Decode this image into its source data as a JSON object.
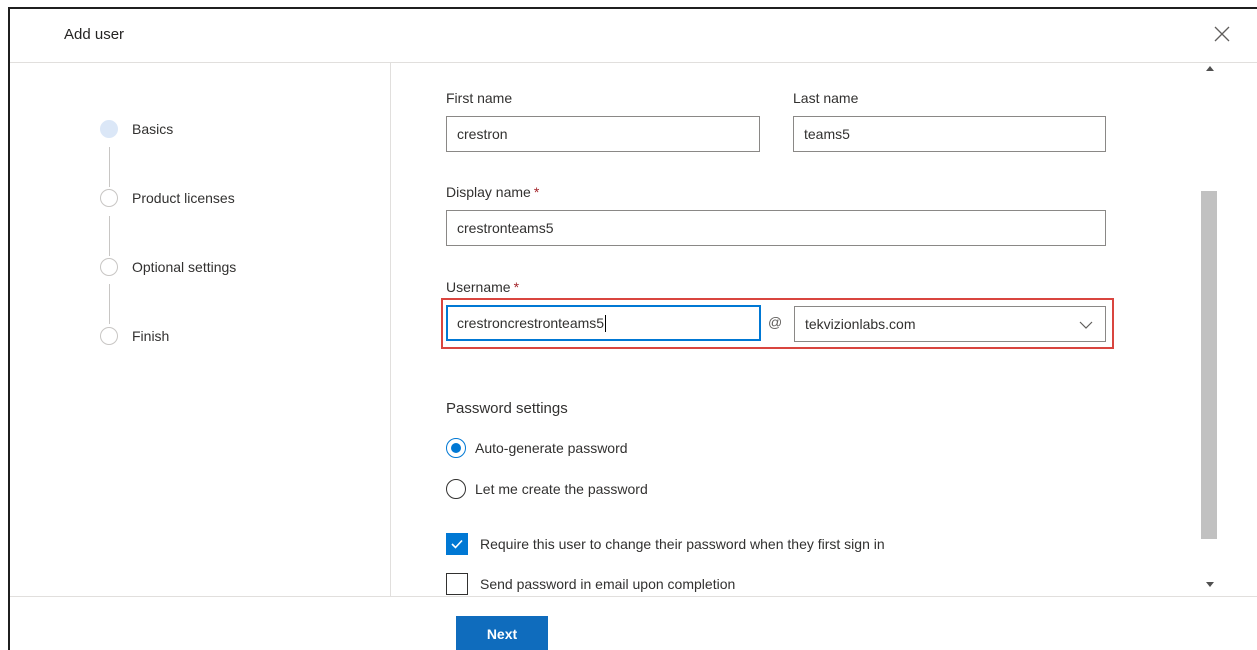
{
  "dialog": {
    "title": "Add user"
  },
  "steps": [
    {
      "label": "Basics",
      "active": true
    },
    {
      "label": "Product licenses",
      "active": false
    },
    {
      "label": "Optional settings",
      "active": false
    },
    {
      "label": "Finish",
      "active": false
    }
  ],
  "form": {
    "first_name_label": "First name",
    "first_name_value": "crestron",
    "last_name_label": "Last name",
    "last_name_value": "teams5",
    "display_name_label": "Display name",
    "display_name_value": "crestronteams5",
    "username_label": "Username",
    "username_value": "crestroncrestronteams5",
    "required_marker": "*",
    "at_sign": "@",
    "domain_value": "tekvizionlabs.com"
  },
  "password": {
    "section_title": "Password settings",
    "radio_auto": "Auto-generate password",
    "radio_manual": "Let me create the password",
    "selected": "auto",
    "check_require_change": "Require this user to change their password when they first sign in",
    "check_require_change_checked": true,
    "check_send_email": "Send password in email upon completion",
    "check_send_email_checked": false
  },
  "footer": {
    "next_label": "Next"
  },
  "colors": {
    "accent": "#0078d4",
    "highlight": "#d9453f",
    "required": "#a4262c"
  },
  "icons": {
    "close": "close-icon",
    "dropdown": "chevron-down-icon",
    "check": "checkmark-icon"
  }
}
